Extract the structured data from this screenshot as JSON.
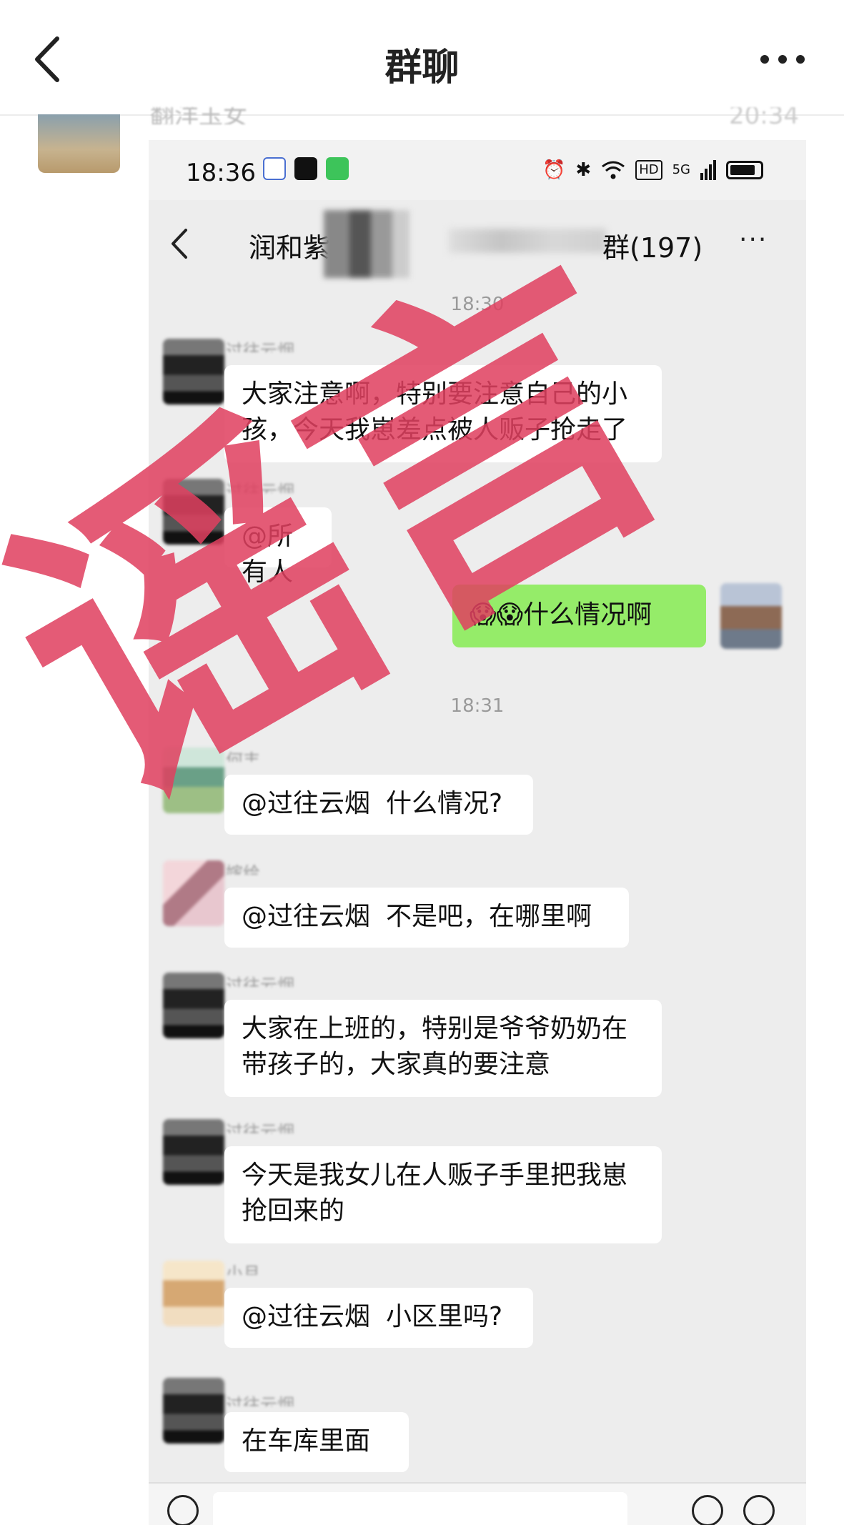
{
  "outer": {
    "title": "群聊",
    "forward_sender": "翻洋玉女",
    "forward_time": "20:34"
  },
  "screenshot": {
    "status_bar": {
      "time": "18:36",
      "network": "5G",
      "hd": "HD"
    },
    "chat_header": {
      "title_left": "润和紫",
      "title_right": "群(197)"
    },
    "timestamps": [
      "18:30",
      "18:31"
    ],
    "messages": [
      {
        "sender": "过往云烟",
        "line1": "大家注意啊，特别要注意自己的小",
        "line2": "孩，今天我崽差点被人贩子抢走了"
      },
      {
        "sender": "过往云烟",
        "text": "@所有人"
      },
      {
        "mine": true,
        "emoji": "😱😱",
        "text": "什么情况啊"
      },
      {
        "sender": "何丰",
        "mention": "@过往云烟",
        "text": "什么情况?"
      },
      {
        "sender": "嫁给",
        "mention": "@过往云烟",
        "text": "不是吧，在哪里啊"
      },
      {
        "sender": "过往云烟",
        "line1": "大家在上班的，特别是爷爷奶奶在",
        "line2": "带孩子的，大家真的要注意"
      },
      {
        "sender": "过往云烟",
        "line1": "今天是我女儿在人贩子手里把我崽",
        "line2": "抢回来的"
      },
      {
        "sender": "小月",
        "mention": "@过往云烟",
        "text": "小区里吗?"
      },
      {
        "sender": "过往云烟",
        "text": "在车库里面"
      }
    ]
  },
  "stamp": {
    "text": "谣言",
    "color": "#e0405f"
  },
  "icons": [
    "back-icon",
    "more-icon",
    "alarm-icon",
    "bluetooth-icon",
    "wifi-icon",
    "signal-icon",
    "battery-icon",
    "voice-icon",
    "emoji-icon",
    "plus-icon"
  ]
}
